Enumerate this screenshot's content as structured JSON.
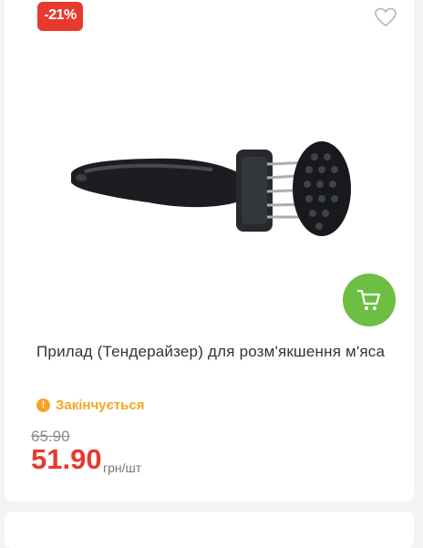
{
  "product": {
    "discount_badge": "-21%",
    "title": "Прилад (Тендерайзер) для розм'якшення м'яса",
    "stock_status": "Закінчується",
    "old_price": "65.90",
    "price": "51.90",
    "unit": "грн/шт"
  },
  "icons": {
    "favorite": "heart-icon",
    "cart": "cart-icon",
    "stock": "exclamation-icon"
  },
  "colors": {
    "accent_red": "#e8392f",
    "cart_green": "#6cbf43",
    "warning_orange": "#f5a623"
  }
}
